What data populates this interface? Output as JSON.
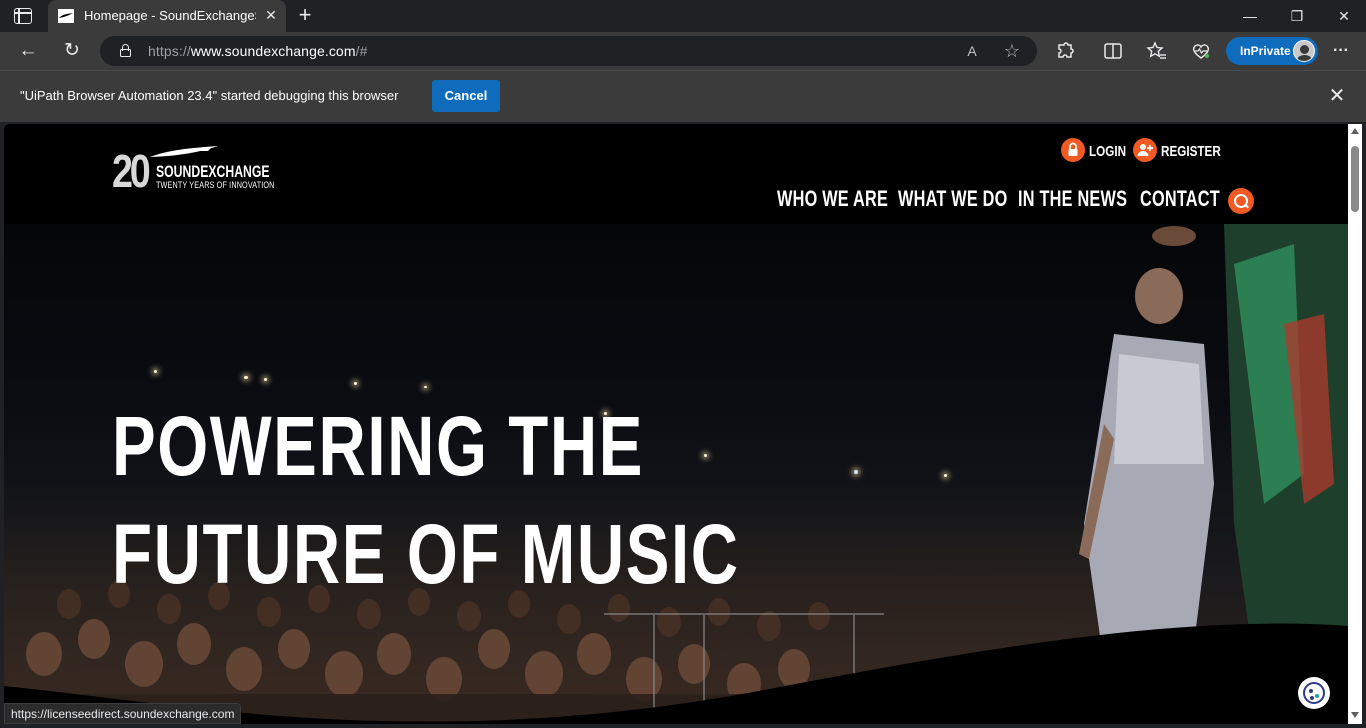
{
  "browser": {
    "tab_title": "Homepage - SoundExchangeSou",
    "tab_close_glyph": "✕",
    "new_tab_glyph": "+",
    "window_controls": {
      "minimize": "—",
      "maximize": "❐",
      "close": "✕"
    },
    "url_scheme": "https://",
    "url_host": "www.soundexchange.com",
    "url_path": "/#",
    "read_aloud_glyph": "A",
    "favorite_glyph": "☆",
    "inprivate_label": "InPrivate",
    "more_glyph": "···",
    "back_glyph": "←",
    "refresh_glyph": "↻"
  },
  "infobar": {
    "message": "\"UiPath Browser Automation 23.4\" started debugging this browser",
    "cancel_label": "Cancel",
    "close_glyph": "✕"
  },
  "site": {
    "logo": {
      "number": "20",
      "name": "SOUNDEXCHANGE",
      "tagline": "TWENTY YEARS OF INNOVATION"
    },
    "auth": {
      "login_label": "LOGIN",
      "register_label": "REGISTER"
    },
    "nav": [
      {
        "label": "WHO WE ARE"
      },
      {
        "label": "WHAT WE DO"
      },
      {
        "label": "IN THE NEWS"
      },
      {
        "label": "CONTACT"
      }
    ],
    "hero": {
      "line1": "POWERING THE",
      "line2": "FUTURE OF MUSIC"
    }
  },
  "status_bar": {
    "hover_url": "https://licenseedirect.soundexchange.com"
  },
  "colors": {
    "brand_accent": "#f15a22",
    "edge_blue": "#0f6cbd",
    "chrome_dark": "#202124",
    "chrome_mid": "#3b3b3b"
  }
}
